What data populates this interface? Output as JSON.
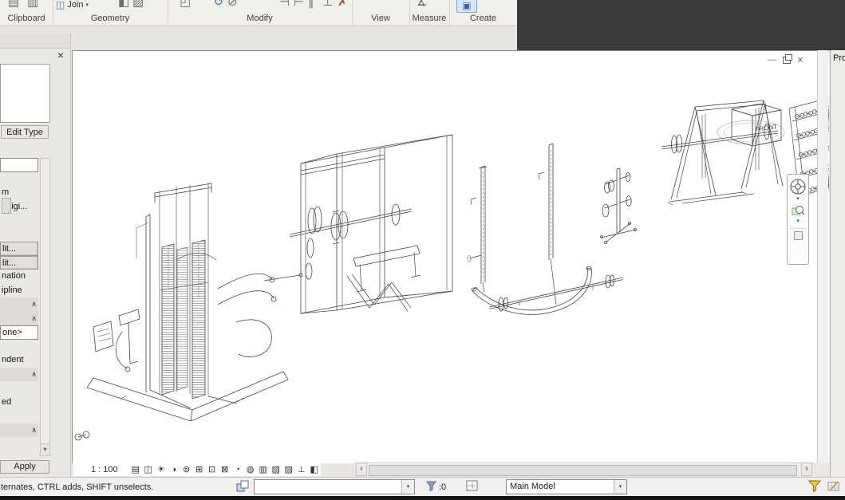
{
  "icons": {
    "paste": "▤",
    "cut": "▥",
    "join": "◫",
    "caret": "▾",
    "cut_geometry": "◧",
    "coping": "▨",
    "modify": "◰",
    "rotate": "↺",
    "split": "⊘",
    "align": "⊣",
    "offset": "⊢",
    "mirror": "∥",
    "array": "⊥",
    "delete": "✗",
    "measure": "∡",
    "create_group": "▣",
    "close": "×",
    "collapse": "∧",
    "scroll_down": "▾",
    "minimize": "—",
    "win_close": "×",
    "left_arrow": "‹",
    "right_arrow": "›"
  },
  "ribbon": {
    "join_label": "Join",
    "panels": [
      "Clipboard",
      "Geometry",
      "Modify",
      "View",
      "Measure",
      "Create"
    ]
  },
  "properties_panel": {
    "edit_type_label": "Edit Type",
    "apply_label": "Apply",
    "rows": [
      {
        "style": "input",
        "text": ""
      },
      {
        "style": "blank",
        "text": ""
      },
      {
        "style": "plain",
        "text": "m"
      },
      {
        "style": "plain",
        "text": "Origi..."
      },
      {
        "style": "blank",
        "text": ""
      },
      {
        "style": "blank",
        "text": ""
      },
      {
        "style": "button",
        "text": "lit..."
      },
      {
        "style": "button",
        "text": "lit..."
      },
      {
        "style": "plain",
        "text": "nation"
      },
      {
        "style": "plain",
        "text": "ipline"
      },
      {
        "style": "header",
        "text": ""
      },
      {
        "style": "header",
        "text": ""
      },
      {
        "style": "input",
        "text": "one>"
      },
      {
        "style": "blank",
        "text": ""
      },
      {
        "style": "plain",
        "text": "ndent"
      },
      {
        "style": "header",
        "text": ""
      },
      {
        "style": "blank",
        "text": ""
      },
      {
        "style": "plain",
        "text": "ed"
      },
      {
        "style": "blank",
        "text": ""
      },
      {
        "style": "header",
        "text": ""
      }
    ]
  },
  "viewport": {
    "scale_label": "1 : 100",
    "front_label": "FRONT",
    "view_control_icons": [
      {
        "name": "detail-level-icon",
        "glyph": "▤"
      },
      {
        "name": "visual-style-icon",
        "glyph": "◫"
      },
      {
        "name": "sun-path-icon",
        "glyph": "☀"
      },
      {
        "name": "shadows-icon",
        "glyph": "◑"
      },
      {
        "name": "rendering-dialog-icon",
        "glyph": "⊚"
      },
      {
        "name": "crop-view-icon",
        "glyph": "⊞"
      },
      {
        "name": "show-crop-region-icon",
        "glyph": "⊡"
      },
      {
        "name": "lock-view-icon",
        "glyph": "⊠"
      },
      {
        "name": "temporary-hide-isolate-icon",
        "glyph": "◔"
      },
      {
        "name": "reveal-hidden-elements-icon",
        "glyph": "◍"
      },
      {
        "name": "temporary-view-properties-icon",
        "glyph": "▥"
      },
      {
        "name": "hide-analytical-model-icon",
        "glyph": "▧"
      },
      {
        "name": "highlight-displacement-icon",
        "glyph": "▨"
      },
      {
        "name": "reveal-constraints-icon",
        "glyph": "⊥"
      },
      {
        "name": "worksharing-display-icon",
        "glyph": "◧"
      }
    ]
  },
  "right_panel": {
    "title": "Pro"
  },
  "status_bar": {
    "hint": "ternates, CTRL adds, SHIFT unselects.",
    "selection_count": ":0",
    "workset_value": "",
    "design_option_value": "Main Model"
  }
}
